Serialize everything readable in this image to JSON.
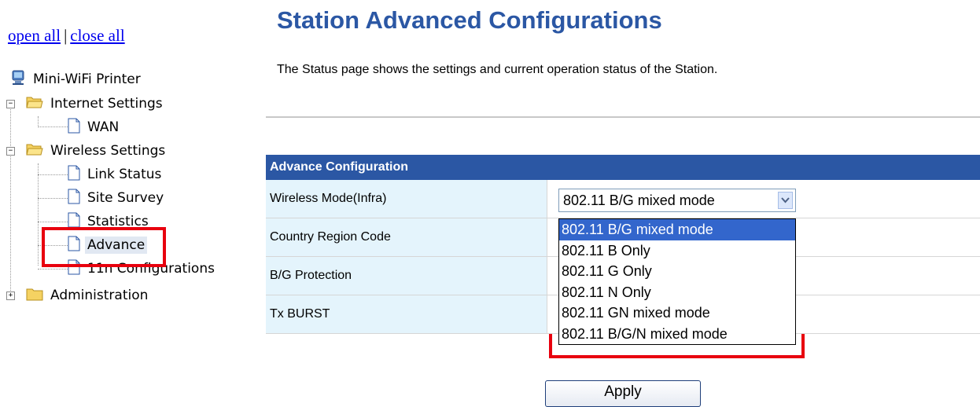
{
  "nav": {
    "open_all": "open all",
    "close_all": "close all",
    "separator": "|"
  },
  "tree": {
    "root": {
      "label": "Mini-WiFi Printer",
      "icon": "computer-icon"
    },
    "internet": {
      "label": "Internet Settings",
      "expander": "−",
      "items": [
        "WAN"
      ]
    },
    "wireless": {
      "label": "Wireless Settings",
      "expander": "−",
      "items": [
        "Link Status",
        "Site Survey",
        "Statistics",
        "Advance",
        "11n Configurations"
      ],
      "selected": "Advance"
    },
    "admin": {
      "label": "Administration",
      "expander": "+"
    }
  },
  "page": {
    "title": "Station Advanced Configurations",
    "description": "The Status page shows the settings and current operation status of the Station."
  },
  "config": {
    "header": "Advance Configuration",
    "rows": [
      "Wireless Mode(Infra)",
      "Country Region Code",
      "B/G Protection",
      "Tx BURST"
    ]
  },
  "wireless_mode": {
    "selected": "802.11 B/G mixed mode",
    "options": [
      "802.11 B/G mixed mode",
      "802.11 B Only",
      "802.11 G Only",
      "802.11 N Only",
      "802.11 GN mixed mode",
      "802.11 B/G/N mixed mode"
    ],
    "highlighted_index": 0
  },
  "actions": {
    "apply": "Apply"
  },
  "colors": {
    "title": "#2b57a4",
    "header_bg": "#2b57a4",
    "label_bg": "#e4f4fc",
    "highlight": "#3366cc",
    "annotation_red": "#e8000e"
  }
}
